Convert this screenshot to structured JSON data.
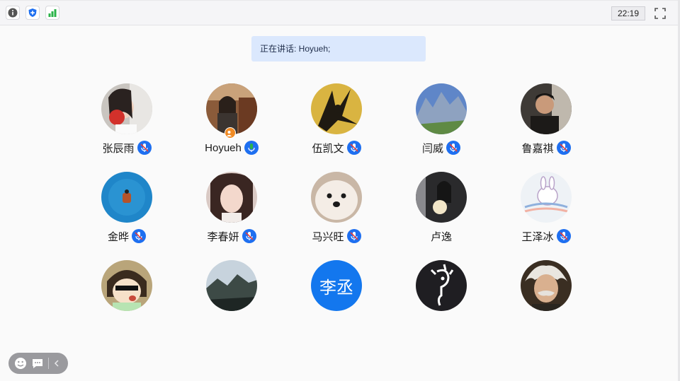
{
  "toolbar": {
    "icons": [
      "info-icon",
      "shield-icon",
      "signal-icon"
    ],
    "time": "22:19",
    "fullscreen_icon": "fullscreen-icon"
  },
  "speaking": {
    "text": "正在讲话: Hoyueh;"
  },
  "colors": {
    "accent": "#1e6ff0",
    "mic_active": "#2bb34a",
    "host_badge": "#f08a24",
    "speaking_bg": "#dbe8fd"
  },
  "participants": [
    {
      "name": "张辰雨",
      "mic": "muted"
    },
    {
      "name": "Hoyueh",
      "mic": "active",
      "host": true
    },
    {
      "name": "伍凯文",
      "mic": "muted"
    },
    {
      "name": "闫威",
      "mic": "muted"
    },
    {
      "name": "鲁嘉祺",
      "mic": "muted"
    },
    {
      "name": "金晔",
      "mic": "muted"
    },
    {
      "name": "李春妍",
      "mic": "muted"
    },
    {
      "name": "马兴旺",
      "mic": "muted"
    },
    {
      "name": "卢逸",
      "mic": "none"
    },
    {
      "name": "王泽冰",
      "mic": "muted"
    },
    {
      "name": "",
      "mic": "none"
    },
    {
      "name": "",
      "mic": "none"
    },
    {
      "name": "",
      "mic": "none",
      "avatar_text": "李丞"
    },
    {
      "name": "",
      "mic": "none"
    },
    {
      "name": "",
      "mic": "none"
    }
  ],
  "bottom_controls": [
    "emoji-icon",
    "chat-icon",
    "collapse-icon"
  ]
}
